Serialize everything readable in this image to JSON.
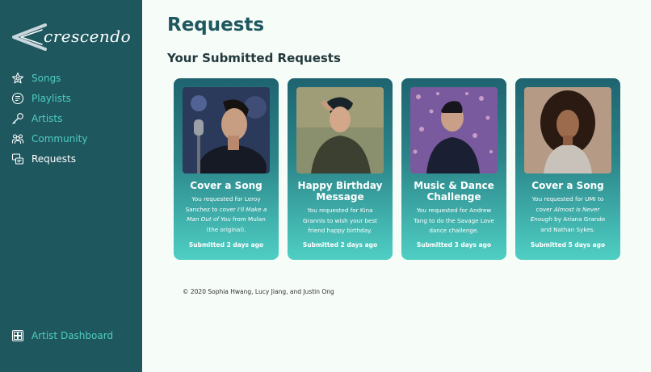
{
  "sidebar": {
    "logo_text": "crescendo",
    "items": [
      {
        "label": "Songs",
        "icon": "star-icon"
      },
      {
        "label": "Playlists",
        "icon": "playlist-icon"
      },
      {
        "label": "Artists",
        "icon": "microphone-icon"
      },
      {
        "label": "Community",
        "icon": "community-icon"
      },
      {
        "label": "Requests",
        "icon": "requests-icon",
        "active": true
      }
    ],
    "dashboard_label": "Artist Dashboard"
  },
  "main": {
    "title": "Requests",
    "section_title": "Your Submitted Requests",
    "cards": [
      {
        "title": "Cover a Song",
        "desc_pre": "You requested for Leroy Sanchez to cover ",
        "desc_italic": "I'll Make a Man Out of You",
        "desc_post": " from Mulan (the original).",
        "time": "Submitted 2 days ago"
      },
      {
        "title": "Happy Birthday Message",
        "desc_pre": "You requested for Kina Grannis to wish your best friend happy birthday.",
        "desc_italic": "",
        "desc_post": "",
        "time": "Submitted 2 days ago"
      },
      {
        "title": "Music & Dance Challenge",
        "desc_pre": "You requested for Andrew Tang to do the Savage Love dance challenge.",
        "desc_italic": "",
        "desc_post": "",
        "time": "Submitted 3 days ago"
      },
      {
        "title": "Cover a Song",
        "desc_pre": "You requested for UMI to cover ",
        "desc_italic": "Almost is Never Enough",
        "desc_post": " by Ariana Grande and Nathan Sykes.",
        "time": "Submitted 5 days ago"
      }
    ]
  },
  "footer": "© 2020 Sophia Hwang, Lucy Jiang, and Justin Ong",
  "colors": {
    "sidebar_bg": "#1f575f",
    "accent": "#4ecdc0",
    "title": "#1f575f",
    "page_bg": "#f6fcf8"
  }
}
